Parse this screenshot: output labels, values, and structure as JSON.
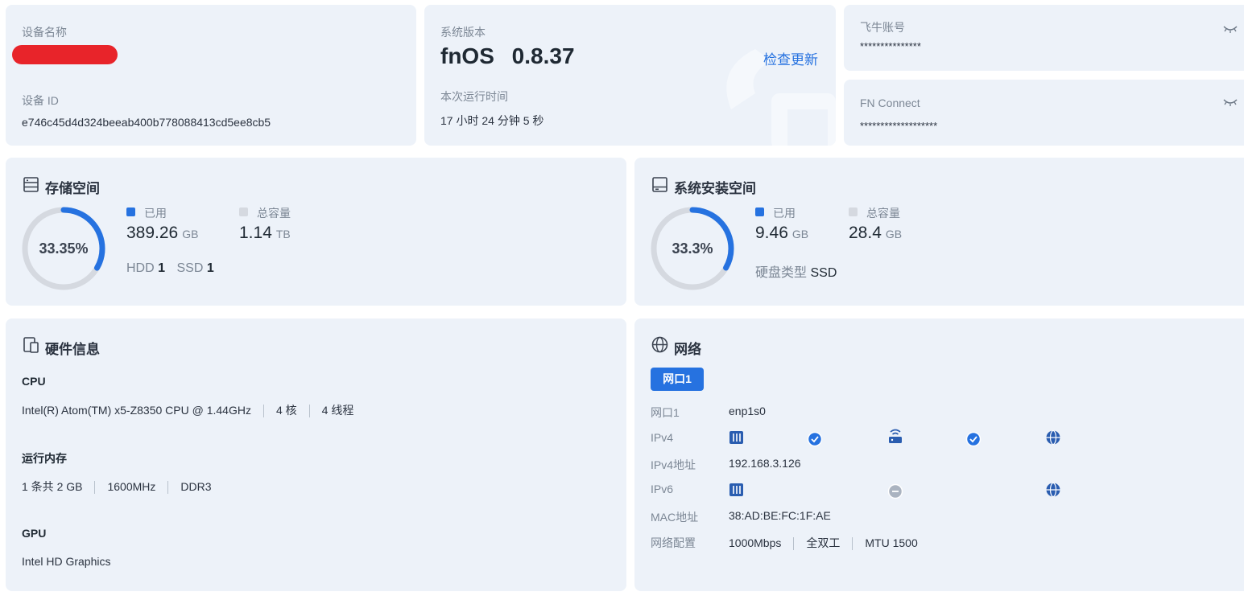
{
  "device": {
    "name_label": "设备名称",
    "id_label": "设备 ID",
    "id_value": "e746c45d4d324beeab400b778088413cd5ee8cb5"
  },
  "system": {
    "version_label": "系统版本",
    "os_name": "fnOS",
    "version": "0.8.37",
    "check_update": "检查更新",
    "uptime_label": "本次运行时间",
    "uptime_value": "17 小时 24 分钟 5 秒"
  },
  "account": {
    "label": "飞牛账号",
    "value": "***************"
  },
  "fn_connect": {
    "label": "FN Connect",
    "value": "*******************"
  },
  "storage": {
    "title": "存储空间",
    "percent_text": "33.35%",
    "percent": 0.3335,
    "used_label": "已用",
    "used_value": "389.26",
    "used_unit": "GB",
    "total_label": "总容量",
    "total_value": "1.14",
    "total_unit": "TB",
    "hdd_label": "HDD",
    "hdd_count": "1",
    "ssd_label": "SSD",
    "ssd_count": "1"
  },
  "system_space": {
    "title": "系统安装空间",
    "percent_text": "33.3%",
    "percent": 0.333,
    "used_label": "已用",
    "used_value": "9.46",
    "used_unit": "GB",
    "total_label": "总容量",
    "total_value": "28.4",
    "total_unit": "GB",
    "disk_type_label": "硬盘类型",
    "disk_type_value": "SSD"
  },
  "hardware": {
    "title": "硬件信息",
    "cpu_label": "CPU",
    "cpu_model": "Intel(R) Atom(TM) x5-Z8350 CPU @ 1.44GHz",
    "cpu_cores": "4 核",
    "cpu_threads": "4 线程",
    "mem_label": "运行内存",
    "mem_count": "1 条共 2 GB",
    "mem_freq": "1600MHz",
    "mem_type": "DDR3",
    "gpu_label": "GPU",
    "gpu_model": "Intel HD Graphics"
  },
  "network": {
    "title": "网络",
    "tab": "网口1",
    "port_label": "网口1",
    "port_value": "enp1s0",
    "ipv4_label": "IPv4",
    "ipv4_addr_label": "IPv4地址",
    "ipv4_addr_value": "192.168.3.126",
    "ipv6_label": "IPv6",
    "mac_label": "MAC地址",
    "mac_value": "38:AD:BE:FC:1F:AE",
    "config_label": "网络配置",
    "speed": "1000Mbps",
    "duplex": "全双工",
    "mtu": "MTU 1500"
  },
  "colors": {
    "card_bg": "#edf2f9",
    "accent": "#2672e0",
    "ring_track": "#d5d9e0",
    "redaction": "#e8242a"
  }
}
